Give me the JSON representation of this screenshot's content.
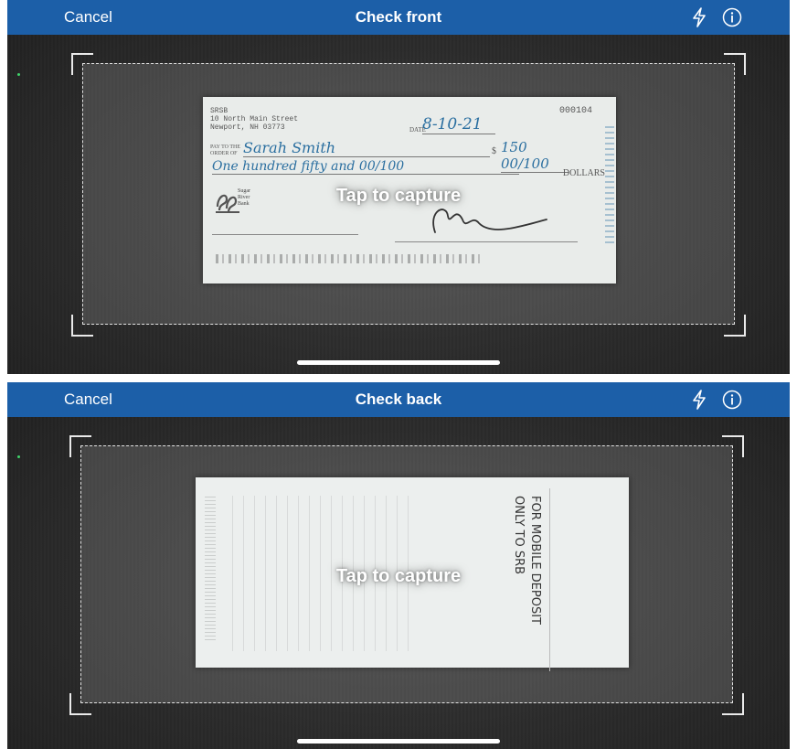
{
  "screens": [
    {
      "nav": {
        "cancel_label": "Cancel",
        "title": "Check front",
        "flash_icon": "flash-icon",
        "info_icon": "info-icon"
      },
      "capture_label": "Tap to capture",
      "check": {
        "bank_name": "SRSB",
        "bank_address_line1": "10 North Main Street",
        "bank_address_line2": "Newport, NH 03773",
        "check_number": "000104",
        "date_label": "DATE",
        "date_value": "8-10-21",
        "pay_to_label": "PAY TO THE\nORDER OF",
        "payee": "Sarah Smith",
        "dollar_sign": "$",
        "amount": "150 00/100",
        "amount_words": "One hundred fifty and 00/100",
        "dollars_label": "DOLLARS",
        "bank_logo_text": "Sugar\nRiver\nBank"
      }
    },
    {
      "nav": {
        "cancel_label": "Cancel",
        "title": "Check back",
        "flash_icon": "flash-icon",
        "info_icon": "info-icon"
      },
      "capture_label": "Tap to capture",
      "check": {
        "endorsement": "FOR MOBILE DEPOSIT\nONLY TO SRB"
      }
    }
  ],
  "colors": {
    "nav_bar": "#1c5fa8",
    "handwriting": "#2b6fa0"
  }
}
